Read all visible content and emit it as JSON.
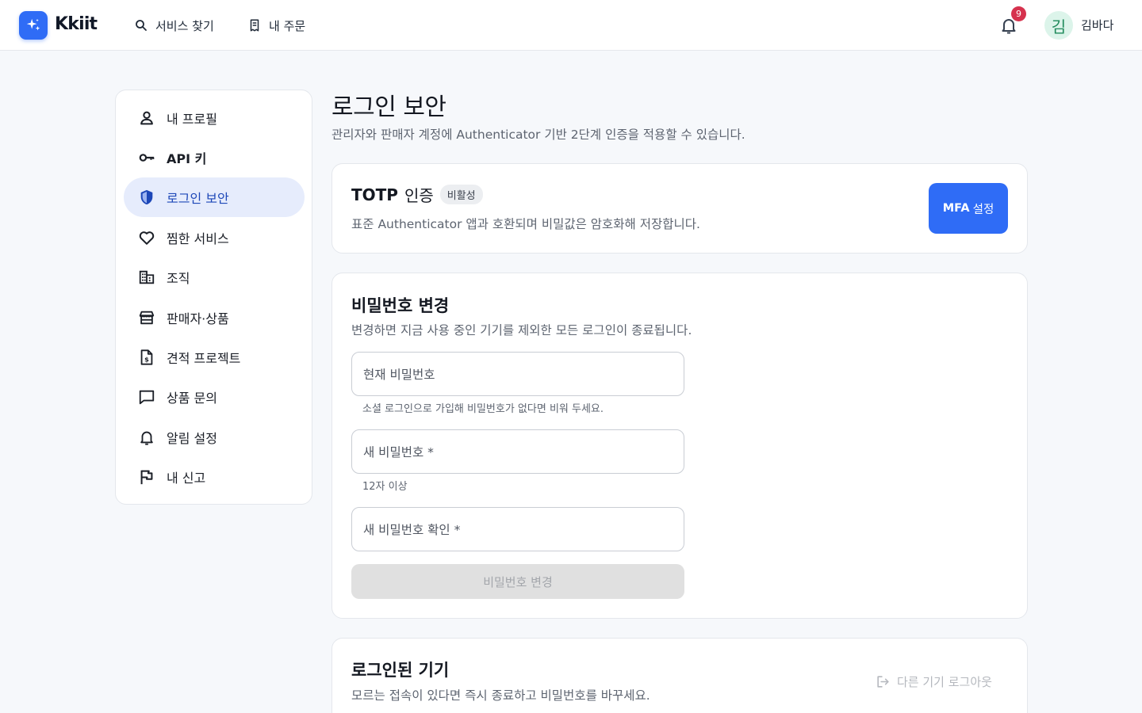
{
  "brand": {
    "name": "Kkiit",
    "color": "#2f6cf6"
  },
  "header": {
    "nav": [
      {
        "label": "서비스 찾기",
        "icon": "search-icon"
      },
      {
        "label": "내 주문",
        "icon": "receipt-icon"
      }
    ],
    "notifications": {
      "count": "9",
      "icon": "bell-icon"
    },
    "user": {
      "avatar_initial": "김",
      "name": "김바다"
    }
  },
  "sidebar": {
    "items": [
      {
        "label": "내 프로필",
        "icon": "user-icon",
        "active": false
      },
      {
        "label": "API 키",
        "icon": "key-icon",
        "active": false
      },
      {
        "label": "로그인 보안",
        "icon": "shield-icon",
        "active": true
      },
      {
        "label": "찜한 서비스",
        "icon": "heart-icon",
        "active": false
      },
      {
        "label": "조직",
        "icon": "building-icon",
        "active": false
      },
      {
        "label": "판매자·상품",
        "icon": "store-icon",
        "active": false
      },
      {
        "label": "견적 프로젝트",
        "icon": "invoice-icon",
        "active": false
      },
      {
        "label": "상품 문의",
        "icon": "chat-icon",
        "active": false
      },
      {
        "label": "알림 설정",
        "icon": "bell-icon",
        "active": false
      },
      {
        "label": "내 신고",
        "icon": "flag-icon",
        "active": false
      }
    ]
  },
  "main": {
    "title": "로그인 보안",
    "subtitle": "관리자와 판매자 계정에 Authenticator 기반 2단계 인증을 적용할 수 있습니다.",
    "totp": {
      "title_strong": "TOTP",
      "title_rest": "인증",
      "status": "비활성",
      "description": "표준 Authenticator 앱과 호환되며 비밀값은 암호화해 저장합니다.",
      "button_strong": "MFA",
      "button_rest": "설정"
    },
    "password": {
      "title": "비밀번호 변경",
      "description": "변경하면 지금 사용 중인 기기를 제외한 모든 로그인이 종료됩니다.",
      "current_label": "현재 비밀번호",
      "current_helper": "소셜 로그인으로 가입해 비밀번호가 없다면 비워 두세요.",
      "new_label": "새 비밀번호 *",
      "new_helper": "12자 이상",
      "confirm_label": "새 비밀번호 확인 *",
      "submit_label": "비밀번호 변경"
    },
    "devices": {
      "title": "로그인된 기기",
      "description": "모르는 접속이 있다면 즉시 종료하고 비밀번호를 바꾸세요.",
      "logout_others_label": "다른 기기 로그아웃"
    }
  }
}
